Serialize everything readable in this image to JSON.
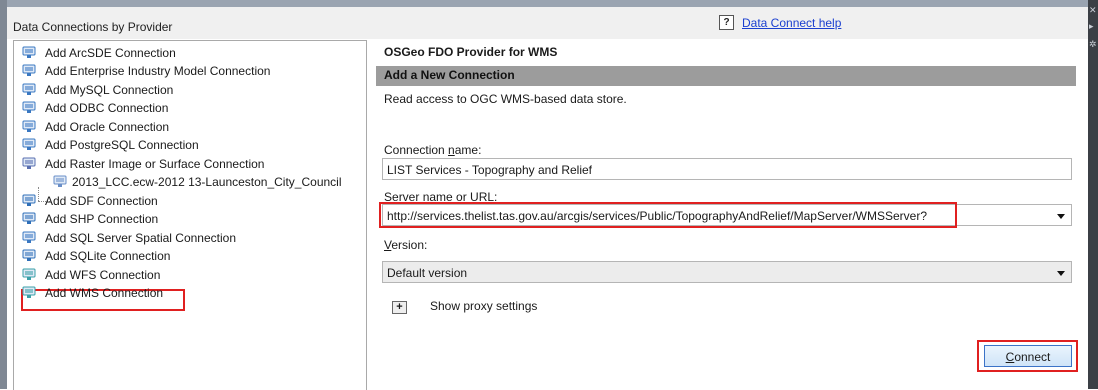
{
  "header": {
    "title": "Data Connections by Provider",
    "help_icon": "?",
    "help_link": "Data Connect help"
  },
  "tree": {
    "items": [
      {
        "label": "Add ArcSDE Connection",
        "icon": "database-connection-icon"
      },
      {
        "label": "Add Enterprise Industry Model Connection",
        "icon": "database-connection-icon"
      },
      {
        "label": "Add MySQL Connection",
        "icon": "database-connection-icon"
      },
      {
        "label": "Add ODBC Connection",
        "icon": "database-connection-icon"
      },
      {
        "label": "Add Oracle Connection",
        "icon": "database-connection-icon"
      },
      {
        "label": "Add PostgreSQL Connection",
        "icon": "database-connection-icon"
      },
      {
        "label": "Add Raster Image or Surface Connection",
        "icon": "raster-connection-icon"
      },
      {
        "label": "2013_LCC.ecw-2012 13-Launceston_City_Council",
        "icon": "raster-file-icon"
      },
      {
        "label": "Add SDF Connection",
        "icon": "file-connection-icon"
      },
      {
        "label": "Add SHP Connection",
        "icon": "file-connection-icon"
      },
      {
        "label": "Add SQL Server Spatial Connection",
        "icon": "database-connection-icon"
      },
      {
        "label": "Add SQLite Connection",
        "icon": "file-connection-icon"
      },
      {
        "label": "Add WFS Connection",
        "icon": "web-service-icon"
      },
      {
        "label": "Add WMS Connection",
        "icon": "web-service-icon"
      }
    ]
  },
  "panel": {
    "provider_title": "OSGeo FDO Provider for WMS",
    "section_title": "Add a New Connection",
    "description": "Read access to OGC WMS-based data store.",
    "connection_name_label_pre": "Connection ",
    "connection_name_label_u": "n",
    "connection_name_label_post": "ame:",
    "connection_name_value": "LIST Services - Topography and Relief",
    "server_label_pre": "",
    "server_label_u": "S",
    "server_label_post": "erver name or URL:",
    "server_value": "http://services.thelist.tas.gov.au/arcgis/services/Public/TopographyAndRelief/MapServer/WMSServer?",
    "version_label_pre": "",
    "version_label_u": "V",
    "version_label_post": "ersion:",
    "version_value": "Default version",
    "proxy_toggle": "+",
    "proxy_label": "Show proxy settings",
    "connect_u": "C",
    "connect_rest": "onnect"
  },
  "colors": {
    "highlight": "#e02020",
    "section_bar": "#9c9c9c",
    "link": "#1a3fd0"
  }
}
